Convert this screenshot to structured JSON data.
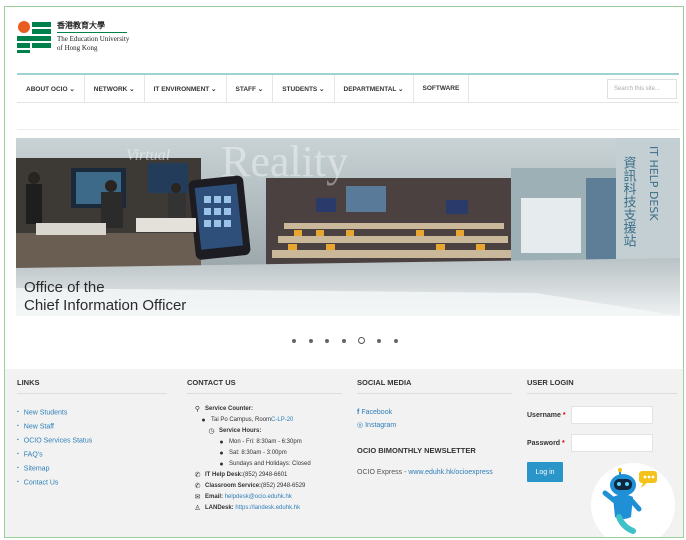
{
  "header": {
    "logo_zh": "香港教育大學",
    "logo_en_1": "The Education University",
    "logo_en_2": "of Hong Kong"
  },
  "nav": {
    "items": [
      {
        "label": "ABOUT OCIO ⌄"
      },
      {
        "label": "NETWORK ⌄"
      },
      {
        "label": "IT ENVIRONMENT ⌄"
      },
      {
        "label": "STAFF ⌄"
      },
      {
        "label": "STUDENTS ⌄"
      },
      {
        "label": "DEPARTMENTAL ⌄"
      },
      {
        "label": "SOFTWARE"
      }
    ],
    "search_placeholder": "Search this site..."
  },
  "banner": {
    "title_1": "Office of the",
    "title_2": "Chief Information Officer",
    "word_reality": "Reality",
    "word_virtual": "Virtual",
    "helpdesk_en": "IT HELP DESK",
    "helpdesk_zh": "資訊科技支援站",
    "slide_count": 7,
    "active_slide": 5
  },
  "footer": {
    "links": {
      "title": "LINKS",
      "items": [
        "New Students",
        "New Staff",
        "OCIO Services Status",
        "FAQ's",
        "Sitemap",
        "Contact Us"
      ]
    },
    "contact": {
      "title": "CONTACT US",
      "service_counter": "Service Counter:",
      "location": "Tai Po Campus, Room ",
      "room": "C-LP-20",
      "service_hours": "Service Hours:",
      "hours_1": "Mon - Fri: 8:30am - 6:30pm",
      "hours_2": "Sat: 8:30am - 3:00pm",
      "hours_3": "Sundays and Holidays: Closed",
      "helpdesk_label": "IT Help Desk:",
      "helpdesk_value": " (852) 2948-6601",
      "classroom_label": "Classroom Service:",
      "classroom_value": " (852) 2948-6529",
      "email_label": "Email:",
      "email_value": "helpdesk@ocio.eduhk.hk",
      "landesk_label": "LANDesk:",
      "landesk_value": "https://landesk.eduhk.hk"
    },
    "social": {
      "title": "SOCIAL MEDIA",
      "facebook": "Facebook",
      "instagram": "Instagram",
      "newsletter_title": "OCIO BIMONTHLY NEWSLETTER",
      "newsletter_text": "OCIO Express - ",
      "newsletter_link": "www.eduhk.hk/ocioexpress"
    },
    "login": {
      "title": "USER LOGIN",
      "username_label": "Username",
      "password_label": "Password",
      "required_mark": "*",
      "button": "Log in"
    }
  }
}
